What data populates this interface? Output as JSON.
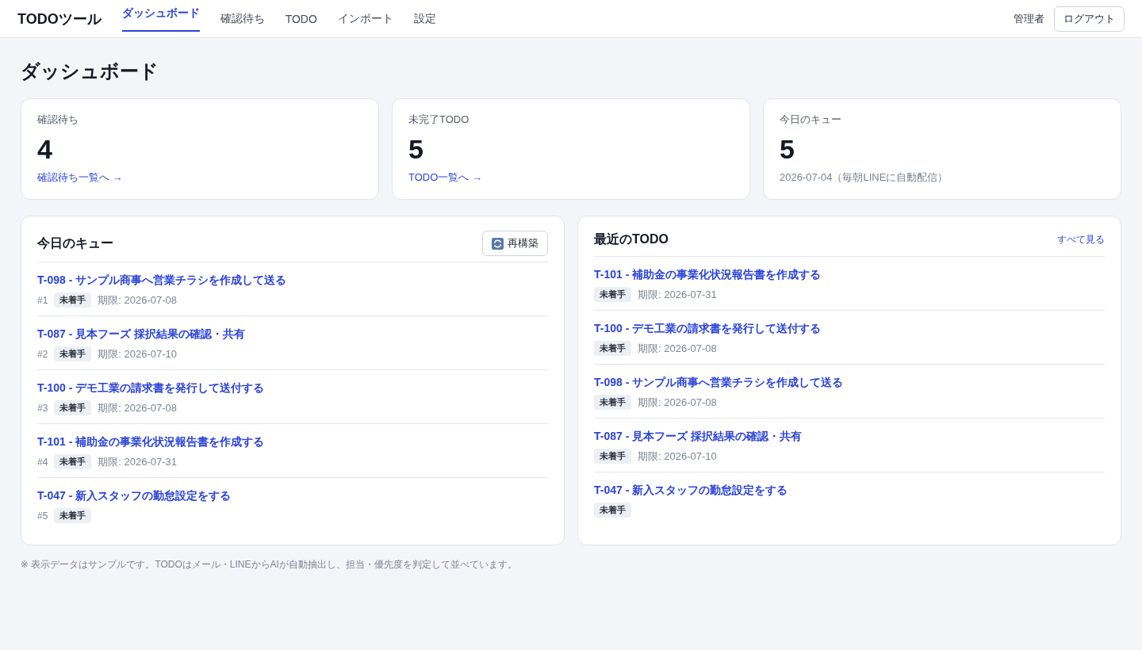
{
  "header": {
    "logo": "TODOツール",
    "nav": [
      {
        "label": "ダッシュボード",
        "selected": true
      },
      {
        "label": "確認待ち",
        "selected": false
      },
      {
        "label": "TODO",
        "selected": false
      },
      {
        "label": "インポート",
        "selected": false
      },
      {
        "label": "設定",
        "selected": false
      }
    ],
    "user": "管理者",
    "logout": "ログアウト"
  },
  "page_title": "ダッシュボード",
  "stats": [
    {
      "kind": "link",
      "label": "確認待ち",
      "value": "4",
      "footer": "確認待ち一覧へ →"
    },
    {
      "kind": "link",
      "label": "未完了TODO",
      "value": "5",
      "footer": "TODO一覧へ →"
    },
    {
      "kind": "note",
      "label": "今日のキュー",
      "value": "5",
      "footer": "2026-07-04（毎朝LINEに自動配信）"
    }
  ],
  "queue": {
    "title": "今日のキュー",
    "rebuild_button": "再構築",
    "items": [
      {
        "title": "T-098 - サンプル商事へ営業チラシを作成して送る",
        "rank": "#1",
        "status": "未着手",
        "due": "期限: 2026-07-08"
      },
      {
        "title": "T-087 - 見本フーズ 採択結果の確認・共有",
        "rank": "#2",
        "status": "未着手",
        "due": "期限: 2026-07-10"
      },
      {
        "title": "T-100 - デモ工業の請求書を発行して送付する",
        "rank": "#3",
        "status": "未着手",
        "due": "期限: 2026-07-08"
      },
      {
        "title": "T-101 - 補助金の事業化状況報告書を作成する",
        "rank": "#4",
        "status": "未着手",
        "due": "期限: 2026-07-31"
      },
      {
        "title": "T-047 - 新入スタッフの勤怠設定をする",
        "rank": "#5",
        "status": "未着手"
      }
    ]
  },
  "recent": {
    "title": "最近のTODO",
    "see_all": "すべて見る",
    "items": [
      {
        "title": "T-101 - 補助金の事業化状況報告書を作成する",
        "status": "未着手",
        "due": "期限: 2026-07-31"
      },
      {
        "title": "T-100 - デモ工業の請求書を発行して送付する",
        "status": "未着手",
        "due": "期限: 2026-07-08"
      },
      {
        "title": "T-098 - サンプル商事へ営業チラシを作成して送る",
        "status": "未着手",
        "due": "期限: 2026-07-08"
      },
      {
        "title": "T-087 - 見本フーズ 採択結果の確認・共有",
        "status": "未着手",
        "due": "期限: 2026-07-10"
      },
      {
        "title": "T-047 - 新入スタッフの勤怠設定をする",
        "status": "未着手"
      }
    ]
  },
  "footnote": "※ 表示データはサンプルです。TODOはメール・LINEからAIが自動抽出し、担当・優先度を判定して並べています。"
}
